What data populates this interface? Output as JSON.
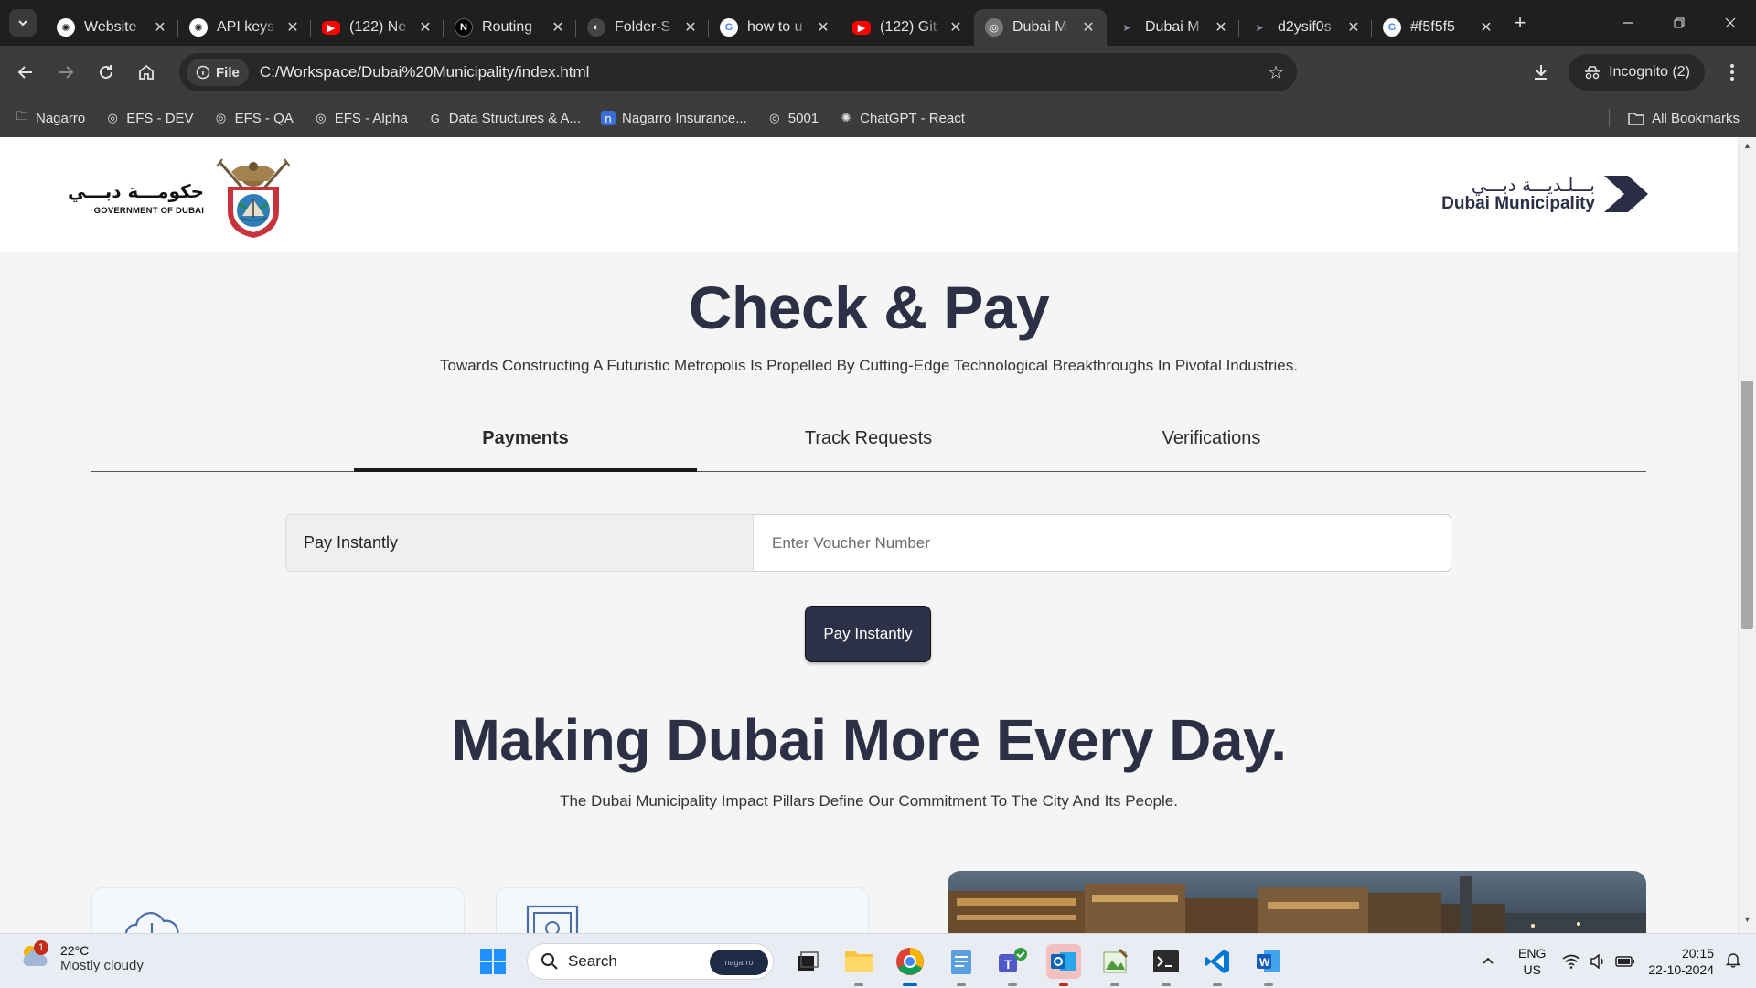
{
  "browser": {
    "tabs": [
      {
        "title": "Website",
        "favicon": "openai-icon",
        "color": "#ffffff"
      },
      {
        "title": "API keys",
        "favicon": "openai-icon",
        "color": "#8b7cf6"
      },
      {
        "title": "(122) Ne",
        "favicon": "youtube-icon",
        "color": "#ff0000"
      },
      {
        "title": "Routing",
        "favicon": "nextjs-icon",
        "color": "#000000"
      },
      {
        "title": "Folder-S",
        "favicon": "github-icon",
        "color": "#444444"
      },
      {
        "title": "how to u",
        "favicon": "google-icon",
        "color": "#ffffff"
      },
      {
        "title": "(122) Git",
        "favicon": "youtube-icon",
        "color": "#ff0000"
      },
      {
        "title": "Dubai M",
        "favicon": "globe-icon",
        "color": "#777777",
        "active": true
      },
      {
        "title": "Dubai M",
        "favicon": "dm-icon",
        "color": "#2d3147"
      },
      {
        "title": "d2ysif0s",
        "favicon": "dm-icon",
        "color": "#2d3147"
      },
      {
        "title": "#f5f5f5",
        "favicon": "google-icon",
        "color": "#ffffff"
      }
    ],
    "file_chip": "File",
    "url": "C:/Workspace/Dubai%20Municipality/index.html",
    "incognito_label": "Incognito (2)",
    "bookmarks": [
      {
        "label": "Nagarro",
        "icon": "folder-icon"
      },
      {
        "label": "EFS - DEV",
        "icon": "globe-icon"
      },
      {
        "label": "EFS - QA",
        "icon": "globe-icon"
      },
      {
        "label": "EFS - Alpha",
        "icon": "globe-icon"
      },
      {
        "label": "Data Structures & A...",
        "icon": "google-icon"
      },
      {
        "label": "Nagarro Insurance...",
        "icon": "nagarro-icon"
      },
      {
        "label": "5001",
        "icon": "globe-icon"
      },
      {
        "label": "ChatGPT - React",
        "icon": "openai-icon"
      }
    ],
    "all_bookmarks": "All Bookmarks"
  },
  "header": {
    "gov_arabic": "حكومـــة دبـــي",
    "gov_english": "GOVERNMENT OF DUBAI",
    "dm_arabic": "بـــلـديـــة دبـــي",
    "dm_english": "Dubai Municipality"
  },
  "hero": {
    "title": "Check & Pay",
    "subtitle": "Towards Constructing A Futuristic Metropolis Is Propelled By Cutting-Edge Technological Breakthroughs In Pivotal Industries."
  },
  "tabs": [
    "Payments",
    "Track Requests",
    "Verifications"
  ],
  "active_tab": "Payments",
  "pay_form": {
    "label": "Pay Instantly",
    "placeholder": "Enter Voucher Number",
    "value": "",
    "button": "Pay Instantly"
  },
  "section": {
    "title": "Making Dubai More Every Day.",
    "subtitle": "The Dubai Municipality Impact Pillars Define Our Commitment To The City And Its People."
  },
  "cards": [
    {
      "icon": "cloud-download-icon"
    },
    {
      "icon": "frame-icon"
    }
  ],
  "taskbar": {
    "weather_temp": "22°C",
    "weather_cond": "Mostly cloudy",
    "weather_badge": "1",
    "search_label": "Search",
    "search_pill": "nagarro",
    "lang_top": "ENG",
    "lang_bottom": "US",
    "time": "20:15",
    "date": "22-10-2024"
  },
  "colors": {
    "brand_dark": "#2d3147",
    "page_bg": "#f5f5f5",
    "chrome_dark": "#1f1f1f"
  }
}
